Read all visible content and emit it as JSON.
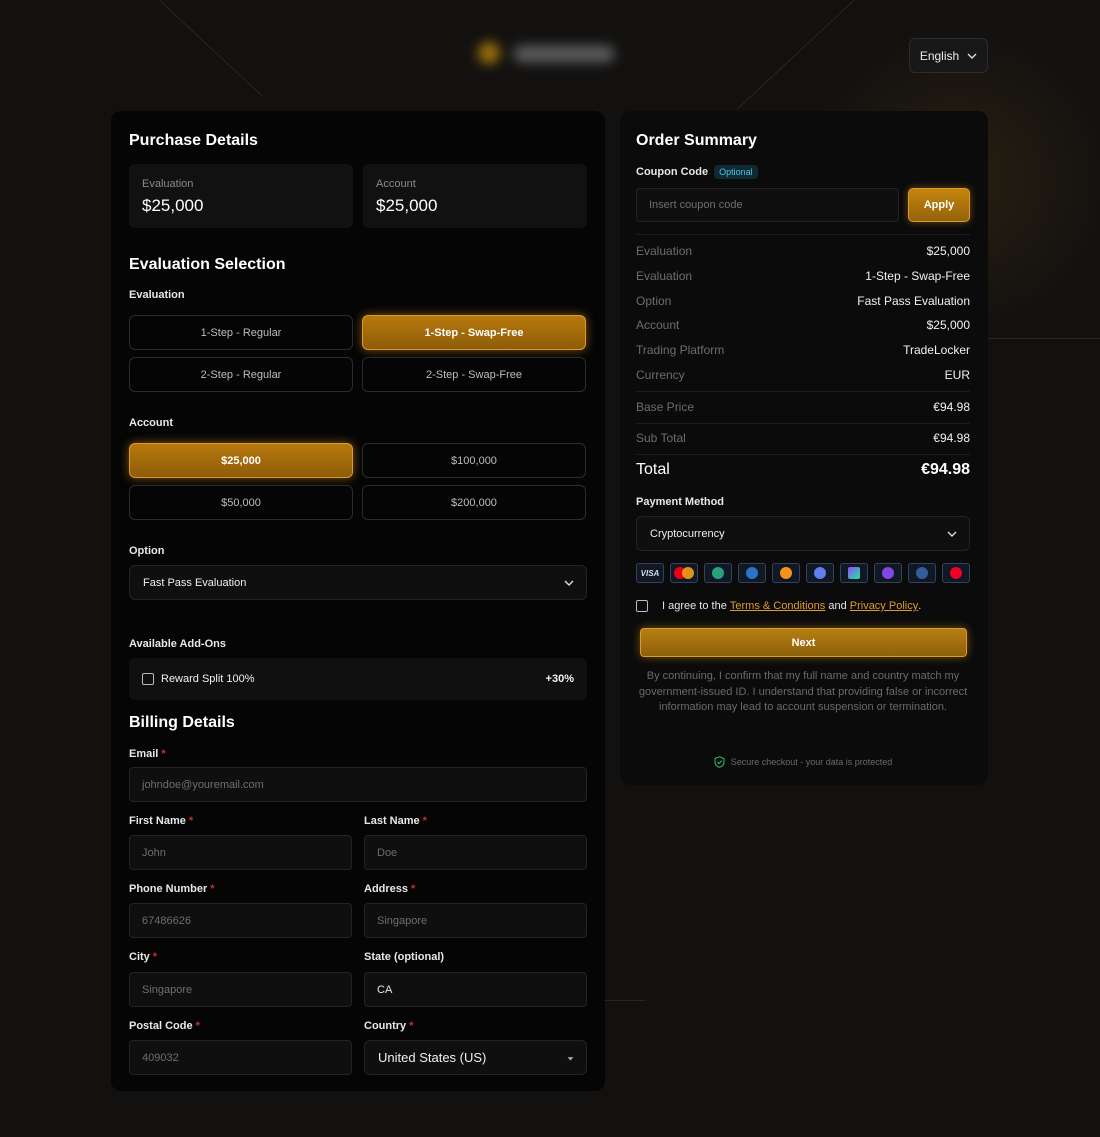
{
  "header": {
    "language": "English"
  },
  "purchase": {
    "title": "Purchase Details",
    "stats": [
      {
        "label": "Evaluation",
        "value": "$25,000"
      },
      {
        "label": "Account",
        "value": "$25,000"
      }
    ]
  },
  "evaluation_selection": {
    "title": "Evaluation Selection",
    "evaluation_label": "Evaluation",
    "evaluation_options": [
      "1-Step - Regular",
      "1-Step - Swap-Free",
      "2-Step - Regular",
      "2-Step - Swap-Free"
    ],
    "evaluation_selected": "1-Step - Swap-Free",
    "account_label": "Account",
    "account_options": [
      "$25,000",
      "$100,000",
      "$50,000",
      "$200,000"
    ],
    "account_selected": "$25,000",
    "option_label": "Option",
    "option_value": "Fast Pass Evaluation",
    "addons_label": "Available Add-Ons",
    "addon_name": "Reward Split 100%",
    "addon_price": "+30%"
  },
  "billing": {
    "title": "Billing Details",
    "email_label": "Email",
    "email_placeholder": "johndoe@youremail.com",
    "first_name_label": "First Name",
    "first_name_placeholder": "John",
    "last_name_label": "Last Name",
    "last_name_placeholder": "Doe",
    "phone_label": "Phone Number",
    "phone_value": "67486626",
    "address_label": "Address",
    "address_placeholder": "Singapore",
    "city_label": "City",
    "city_placeholder": "Singapore",
    "state_label": "State (optional)",
    "state_value": "CA",
    "postal_label": "Postal Code",
    "postal_value": "409032",
    "country_label": "Country",
    "country_value": "United States (US)",
    "required_mark": "*"
  },
  "summary": {
    "title": "Order Summary",
    "coupon_label": "Coupon Code",
    "coupon_badge": "Optional",
    "coupon_placeholder": "Insert coupon code",
    "apply_label": "Apply",
    "rows": [
      {
        "k": "Evaluation",
        "v": "$25,000"
      },
      {
        "k": "Evaluation",
        "v": "1-Step - Swap-Free"
      },
      {
        "k": "Option",
        "v": "Fast Pass Evaluation"
      },
      {
        "k": "Account",
        "v": "$25,000"
      },
      {
        "k": "Trading Platform",
        "v": "TradeLocker"
      },
      {
        "k": "Currency",
        "v": "EUR"
      }
    ],
    "base_price_label": "Base Price",
    "base_price": "€94.98",
    "subtotal_label": "Sub Total",
    "subtotal": "€94.98",
    "total_label": "Total",
    "total": "€94.98",
    "payment_label": "Payment Method",
    "payment_value": "Cryptocurrency",
    "payment_icons": [
      "visa-icon",
      "mastercard-icon",
      "tether-icon",
      "usdc-icon",
      "bitcoin-icon",
      "ethereum-icon",
      "solana-icon",
      "polygon-icon",
      "litecoin-icon",
      "tron-icon"
    ],
    "agree_prefix": "I agree to the",
    "terms_link": "Terms & Conditions",
    "agree_and": "and",
    "privacy_link": "Privacy Policy",
    "agree_suffix": ".",
    "next_label": "Next",
    "disclaimer": "By continuing, I confirm that my full name and country match my government-issued ID. I understand that providing false or incorrect information may lead to account suspension or termination.",
    "secure_text": "Secure checkout - your data is protected"
  },
  "colors": {
    "accent": "#c4850f",
    "link": "#e09b2d",
    "badge": "#4fc3e8",
    "secure": "#2bbf6a"
  }
}
